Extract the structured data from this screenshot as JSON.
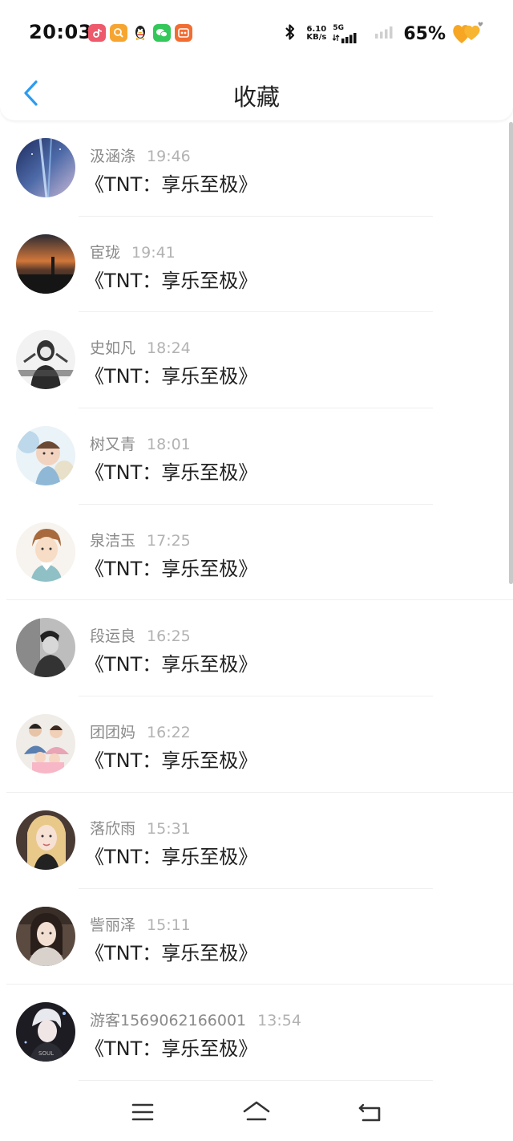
{
  "status_bar": {
    "time": "20:03",
    "net_speed_value": "6.10",
    "net_speed_unit": "KB/s",
    "network_type": "5G",
    "battery": "65%",
    "app_icons": [
      "douyin-icon",
      "orange-app-icon",
      "qq-penguin-icon",
      "wechat-icon",
      "orange-grid-app-icon"
    ],
    "colors": {
      "douyin": "#ee5a6b",
      "orange_app": "#f7a531",
      "wechat": "#34c759",
      "grid_app": "#f26d31"
    }
  },
  "header": {
    "title": "收藏",
    "back_icon": "chevron-left-icon",
    "accent_color": "#2b9cf0"
  },
  "list": [
    {
      "name": "汲涵涤",
      "time": "19:46",
      "text": "《TNT：享乐至极》",
      "avatar": "galaxy-sky"
    },
    {
      "name": "宦珑",
      "time": "19:41",
      "text": "《TNT：享乐至极》",
      "avatar": "sunset-city"
    },
    {
      "name": "史如凡",
      "time": "18:24",
      "text": "《TNT：享乐至极》",
      "avatar": "bw-girl"
    },
    {
      "name": "树又青",
      "time": "18:01",
      "text": "《TNT：享乐至极》",
      "avatar": "child-photo"
    },
    {
      "name": "泉洁玉",
      "time": "17:25",
      "text": "《TNT：享乐至极》",
      "avatar": "anime-boy"
    },
    {
      "name": "段运良",
      "time": "16:25",
      "text": "《TNT：享乐至极》",
      "avatar": "bw-man"
    },
    {
      "name": "团团妈",
      "time": "16:22",
      "text": "《TNT：享乐至极》",
      "avatar": "family-photo"
    },
    {
      "name": "落欣雨",
      "time": "15:31",
      "text": "《TNT：享乐至极》",
      "avatar": "blonde-girl"
    },
    {
      "name": "訾丽泽",
      "time": "15:11",
      "text": "《TNT：享乐至极》",
      "avatar": "girl-indoor"
    },
    {
      "name": "游客1569062166001",
      "time": "13:54",
      "text": "《TNT：享乐至极》",
      "avatar": "anime-dark"
    }
  ],
  "bottom_nav": {
    "icons": [
      "menu-icon",
      "home-icon",
      "back-return-icon"
    ]
  }
}
